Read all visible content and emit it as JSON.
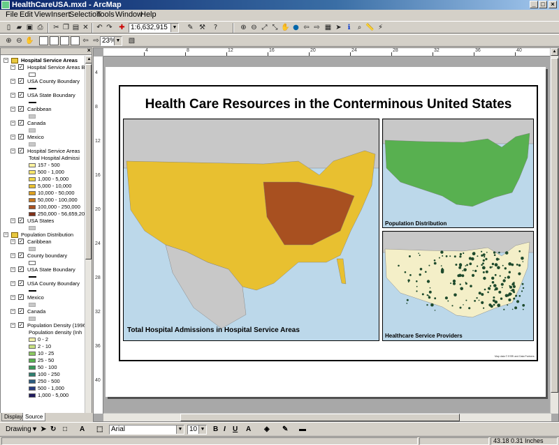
{
  "window": {
    "title": "HealthCareUSA.mxd - ArcMap",
    "controls": [
      "_",
      "□",
      "×"
    ]
  },
  "menu": [
    "File",
    "Edit",
    "View",
    "Insert",
    "Selection",
    "Tools",
    "Window",
    "Help"
  ],
  "toolbar": {
    "scale_value": "1:6,632,915",
    "zoom_value": "23%"
  },
  "toc": {
    "groups": [
      {
        "name": "Hospital Service Areas",
        "layers": [
          {
            "name": "Hospital Service Areas Bo",
            "checked": true,
            "symbol": "box"
          },
          {
            "name": "USA County Boundary",
            "checked": true,
            "symbol": "line"
          },
          {
            "name": "USA State Boundary",
            "checked": true,
            "symbol": "line"
          },
          {
            "name": "Caribbean",
            "checked": true,
            "symbol": "gray"
          },
          {
            "name": "Canada",
            "checked": true,
            "symbol": "gray"
          },
          {
            "name": "Mexico",
            "checked": true,
            "symbol": "gray"
          },
          {
            "name": "Hospital Service Areas",
            "checked": true,
            "field": "Total Hospital Admissi",
            "classes": [
              {
                "label": "157 - 500",
                "color": "#fff3a0"
              },
              {
                "label": "500 - 1,000",
                "color": "#f7e76c"
              },
              {
                "label": "1,000 - 5,000",
                "color": "#f0d848"
              },
              {
                "label": "5,000 - 10,000",
                "color": "#e8c030"
              },
              {
                "label": "10,000 - 50,000",
                "color": "#dca020"
              },
              {
                "label": "50,000 - 100,000",
                "color": "#c87820"
              },
              {
                "label": "100,000 - 250,000",
                "color": "#a85020"
              },
              {
                "label": "250,000 - 56,659,200,",
                "color": "#803018"
              }
            ]
          },
          {
            "name": "USA States",
            "checked": true,
            "symbol": "gray"
          }
        ]
      },
      {
        "name": "Population Distribution",
        "layers": [
          {
            "name": "Caribbean",
            "checked": true,
            "symbol": "gray"
          },
          {
            "name": "County boundary",
            "checked": true,
            "symbol": "box"
          },
          {
            "name": "USA State Boundary",
            "checked": true,
            "symbol": "line"
          },
          {
            "name": "USA County Boundary",
            "checked": true,
            "symbol": "line"
          },
          {
            "name": "Mexico",
            "checked": true,
            "symbol": "gray"
          },
          {
            "name": "Canada",
            "checked": true,
            "symbol": "gray"
          },
          {
            "name": "Population Density (1996)",
            "checked": true,
            "field": "Population density (Inh",
            "classes": [
              {
                "label": "0 - 2",
                "color": "#f2f0a8"
              },
              {
                "label": "2 - 10",
                "color": "#c8e080"
              },
              {
                "label": "10 - 25",
                "color": "#8cc860"
              },
              {
                "label": "25 - 50",
                "color": "#58b050"
              },
              {
                "label": "50 - 100",
                "color": "#3a9858"
              },
              {
                "label": "100 - 250",
                "color": "#2f8070"
              },
              {
                "label": "250 - 500",
                "color": "#2c5c80"
              },
              {
                "label": "500 - 1,000",
                "color": "#283c80"
              },
              {
                "label": "1,000 - 5,000",
                "color": "#201c60"
              }
            ]
          }
        ]
      }
    ],
    "tabs": [
      "Display",
      "Source"
    ]
  },
  "ruler": {
    "h_ticks": [
      "4",
      "8",
      "12",
      "16",
      "20",
      "24",
      "28",
      "32",
      "36",
      "40"
    ],
    "v_ticks": [
      "4",
      "8",
      "12",
      "16",
      "20",
      "24",
      "28",
      "32",
      "36",
      "40"
    ]
  },
  "layout": {
    "title": "Health Care Resources in the Conterminous United States",
    "main_map_caption": "Total Hospital Admissions in Hospital Service Areas",
    "pop_map_caption": "Population Distribution",
    "hsp_map_caption": "Healthcare Service Providers",
    "credits": "Map data © ESRI and Data Partners",
    "colors": {
      "ocean": "#bcd8ea",
      "neighbor_land": "#c8c8c8",
      "main_fill": "#e8c030",
      "main_dark": "#a85020",
      "pop_fill": "#58b050",
      "hsp_fill": "#f4efc8",
      "hsp_dots": "#1e4a2c"
    }
  },
  "drawing": {
    "label": "Drawing",
    "font": "Arial",
    "font_size": "10",
    "bold": "B",
    "italic": "I",
    "underline": "U"
  },
  "status": {
    "coords": "43.18  0.31 Inches"
  }
}
